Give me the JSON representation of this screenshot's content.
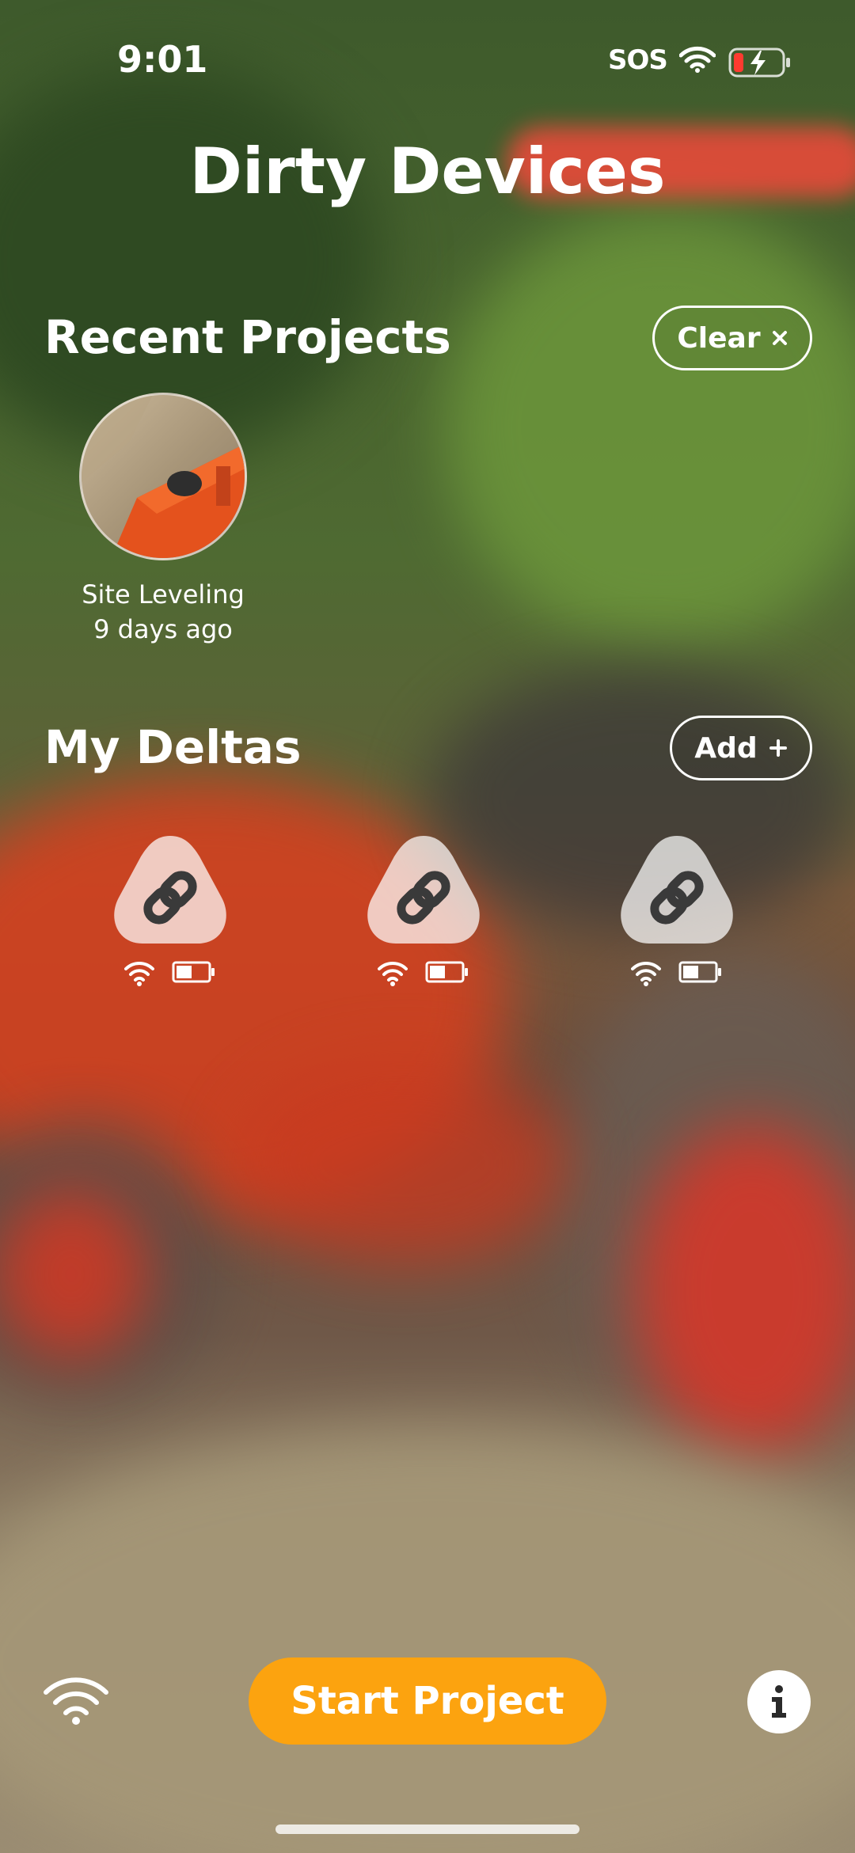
{
  "status_bar": {
    "time": "9:01",
    "carrier": "SOS"
  },
  "app": {
    "title": "Dirty Devices"
  },
  "recent_projects": {
    "heading": "Recent Projects",
    "clear_label": "Clear",
    "clear_icon": "close-icon",
    "items": [
      {
        "name": "Site Leveling",
        "date": "9 days ago"
      }
    ]
  },
  "deltas": {
    "heading": "My Deltas",
    "add_label": "Add",
    "add_icon": "plus-icon",
    "devices": [
      {
        "icon": "link-icon",
        "wifi": "connected",
        "battery_level": 0.5
      },
      {
        "icon": "link-icon",
        "wifi": "connected",
        "battery_level": 0.5
      },
      {
        "icon": "link-icon",
        "wifi": "connected",
        "battery_level": 0.5
      }
    ]
  },
  "bottom_bar": {
    "start_label": "Start Project",
    "start_color": "#fca30f",
    "wifi_icon": "wifi-icon",
    "info_icon": "info-icon"
  }
}
